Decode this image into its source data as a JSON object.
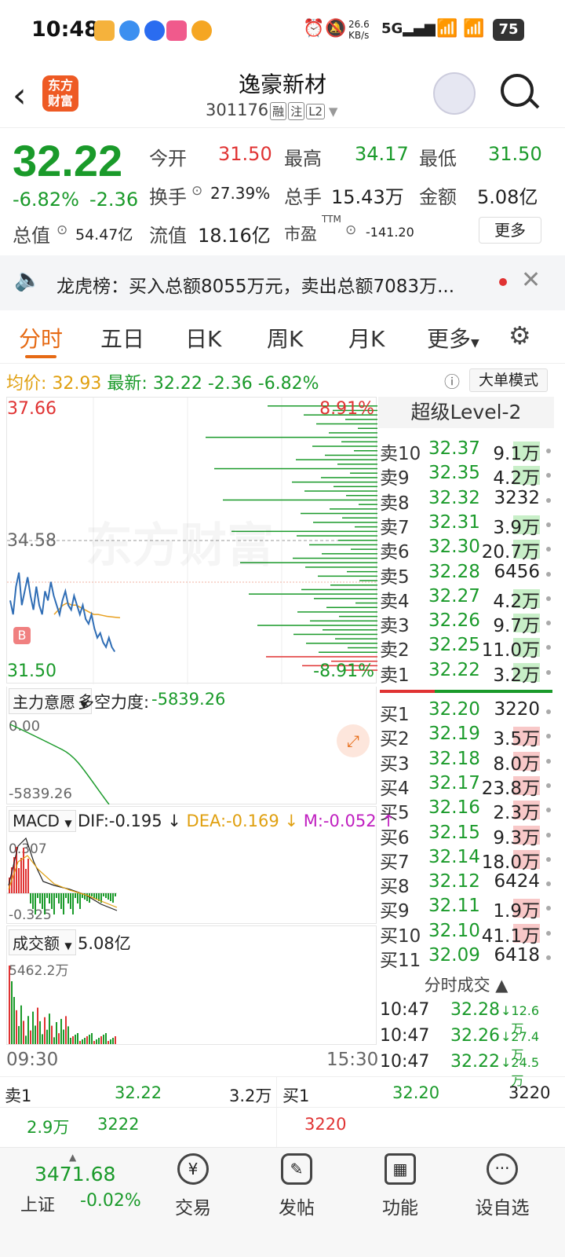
{
  "status": {
    "time": "10:48",
    "net_speed": "26.6 KB/s",
    "battery": "75"
  },
  "header": {
    "title": "逸豪新材",
    "code": "301176",
    "tags": [
      "融",
      "注",
      "L2"
    ]
  },
  "quote": {
    "price": "32.22",
    "pct": "-6.82%",
    "chg": "-2.36",
    "open_label": "今开",
    "open": "31.50",
    "high_label": "最高",
    "high": "34.17",
    "low_label": "最低",
    "low": "31.50",
    "turnover_label": "换手",
    "turnover": "27.39%",
    "volume_label": "总手",
    "volume": "15.43万",
    "amount_label": "金额",
    "amount": "5.08亿",
    "mktcap_label": "总值",
    "mktcap": "54.47亿",
    "float_label": "流值",
    "float": "18.16亿",
    "pe_label": "市盈",
    "pe_sup": "TTM",
    "pe": "-141.20",
    "more": "更多"
  },
  "notice": {
    "text": "龙虎榜：买入总额8055万元，卖出总额7083万..."
  },
  "tabs": [
    "分时",
    "五日",
    "日K",
    "周K",
    "月K",
    "更多"
  ],
  "infoline": {
    "avg_label": "均价:",
    "avg": "32.93",
    "latest_label": "最新:",
    "latest": "32.22",
    "chg": "-2.36",
    "pct": "-6.82%",
    "mode": "大单模式"
  },
  "chart": {
    "y_top": "37.66",
    "y_mid": "34.58",
    "y_bot": "31.50",
    "pct_top": "8.91%",
    "pct_bot": "-8.91%",
    "watermark": "东方财富",
    "marker": "B",
    "time_start": "09:30",
    "time_end": "15:30",
    "price_series": [
      33.3,
      33.0,
      33.6,
      33.9,
      33.2,
      33.5,
      33.8,
      33.4,
      33.1,
      33.6,
      33.2,
      33.0,
      33.5,
      33.3,
      33.7,
      33.4,
      33.2,
      33.0,
      33.3,
      33.5,
      33.2,
      33.1,
      33.4,
      33.2,
      33.0,
      33.2,
      32.9,
      32.8,
      33.0,
      32.7,
      32.5,
      32.6,
      32.4,
      32.3,
      32.5,
      32.3,
      32.2
    ],
    "avg_series": [
      33.0,
      33.1,
      33.2,
      33.25,
      33.2,
      33.2,
      33.15,
      33.1,
      33.05,
      33.0,
      33.0,
      32.98,
      32.96,
      32.95,
      32.94,
      32.93
    ]
  },
  "lvl2_title": "超级Level-2",
  "asks": [
    {
      "label": "卖10",
      "price": "32.37",
      "vol": "9.1万"
    },
    {
      "label": "卖9",
      "price": "32.35",
      "vol": "4.2万"
    },
    {
      "label": "卖8",
      "price": "32.32",
      "vol": "3232"
    },
    {
      "label": "卖7",
      "price": "32.31",
      "vol": "3.9万"
    },
    {
      "label": "卖6",
      "price": "32.30",
      "vol": "20.7万"
    },
    {
      "label": "卖5",
      "price": "32.28",
      "vol": "6456"
    },
    {
      "label": "卖4",
      "price": "32.27",
      "vol": "4.2万"
    },
    {
      "label": "卖3",
      "price": "32.26",
      "vol": "9.7万"
    },
    {
      "label": "卖2",
      "price": "32.25",
      "vol": "11.0万"
    },
    {
      "label": "卖1",
      "price": "32.22",
      "vol": "3.2万"
    }
  ],
  "bids": [
    {
      "label": "买1",
      "price": "32.20",
      "vol": "3220"
    },
    {
      "label": "买2",
      "price": "32.19",
      "vol": "3.5万"
    },
    {
      "label": "买3",
      "price": "32.18",
      "vol": "8.0万"
    },
    {
      "label": "买4",
      "price": "32.17",
      "vol": "23.8万"
    },
    {
      "label": "买5",
      "price": "32.16",
      "vol": "2.3万"
    },
    {
      "label": "买6",
      "price": "32.15",
      "vol": "9.3万"
    },
    {
      "label": "买7",
      "price": "32.14",
      "vol": "18.0万"
    },
    {
      "label": "买8",
      "price": "32.12",
      "vol": "6424"
    },
    {
      "label": "买9",
      "price": "32.11",
      "vol": "1.9万"
    },
    {
      "label": "买10",
      "price": "32.10",
      "vol": "41.1万"
    },
    {
      "label": "买11",
      "price": "32.09",
      "vol": "6418"
    }
  ],
  "ticks_title": "分时成交",
  "ticks": [
    {
      "time": "10:47",
      "price": "32.28",
      "vol": "12.6万"
    },
    {
      "time": "10:47",
      "price": "32.26",
      "vol": "27.4万"
    },
    {
      "time": "10:47",
      "price": "32.22",
      "vol": "24.5万"
    }
  ],
  "panel1": {
    "label": "主力意愿",
    "title": "多空力度:",
    "value": "-5839.26",
    "y_top": "0.00",
    "y_bot": "-5839.26"
  },
  "panel2": {
    "label": "MACD",
    "dif": "DIF:-0.195",
    "dea": "DEA:-0.169",
    "m": "M:-0.052",
    "y_top": "0.307",
    "y_bot": "-0.325"
  },
  "panel3": {
    "label": "成交额",
    "value": "5.08亿",
    "y_top": "5462.2万"
  },
  "bidask": {
    "ask_label": "卖1",
    "ask_price": "32.22",
    "ask_vol": "3.2万",
    "bid_label": "买1",
    "bid_price": "32.20",
    "bid_vol": "3220",
    "ask_q1": "2.9万",
    "ask_q2": "3222",
    "bid_q1": "3220"
  },
  "index": {
    "value": "3471.68",
    "name": "上证",
    "pct": "-0.02%"
  },
  "nav": [
    "交易",
    "发帖",
    "功能",
    "设自选"
  ]
}
